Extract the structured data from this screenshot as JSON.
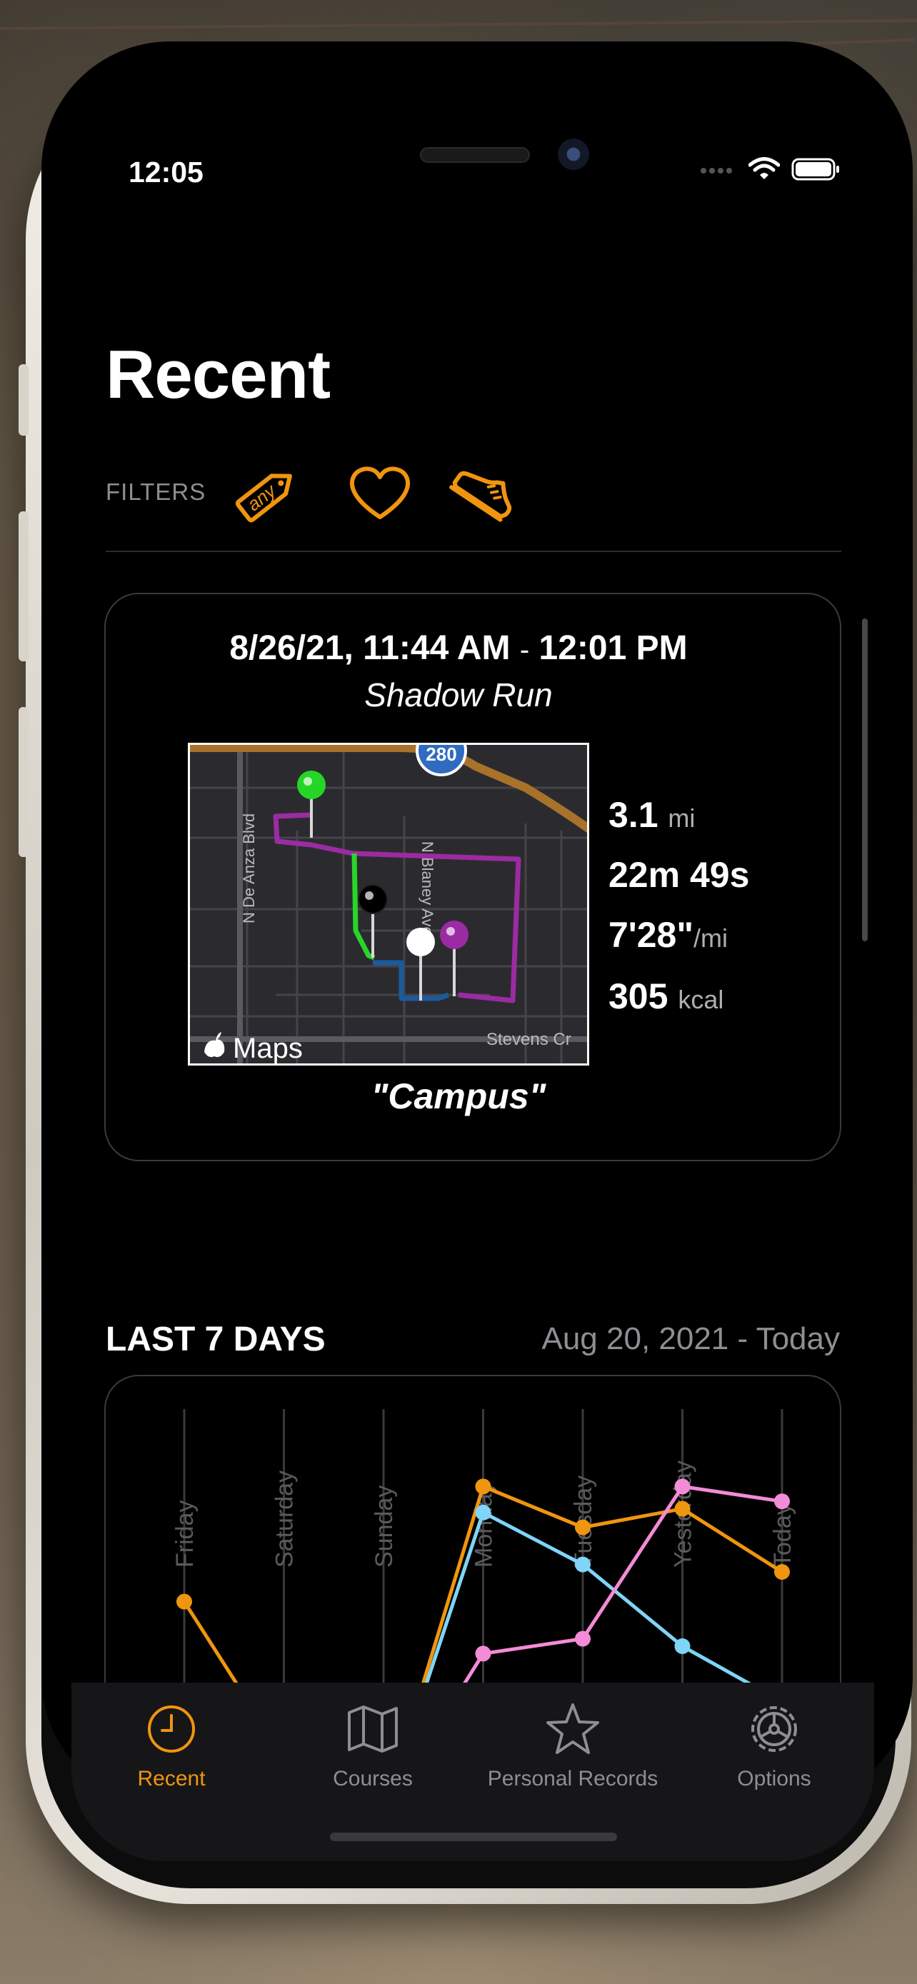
{
  "status": {
    "time": "12:05"
  },
  "header": {
    "title": "Recent"
  },
  "filters": {
    "label": "FILTERS",
    "any_label": "any"
  },
  "recent_run": {
    "time_start": "8/26/21, 11:44 AM",
    "time_sep": "-",
    "time_end": "12:01 PM",
    "subtitle": "Shadow Run",
    "course": "\"Campus\"",
    "map": {
      "shield": "280",
      "road_left": "N De Anza Blvd",
      "road_mid": "N Blaney Ave",
      "road_bottom": "Stevens Cr",
      "attribution": "Maps"
    },
    "stats": [
      {
        "value": "3.1",
        "unit": "mi"
      },
      {
        "value": "22m 49s",
        "unit": ""
      },
      {
        "value": "7'28\"",
        "unit": "/mi"
      },
      {
        "value": "305",
        "unit": "kcal"
      }
    ]
  },
  "last7": {
    "title": "LAST 7 DAYS",
    "range": "Aug 20, 2021  - Today"
  },
  "chart_data": {
    "type": "line",
    "categories": [
      "Friday",
      "Saturday",
      "Sunday",
      "Monday",
      "Tuesday",
      "Yesterday",
      "Today"
    ],
    "series": [
      {
        "color": "#f0950f",
        "values": [
          0.62,
          0.2,
          0.05,
          0.93,
          0.82,
          0.87,
          0.7
        ]
      },
      {
        "color": "#7fd4f7",
        "values": [
          null,
          null,
          0.05,
          0.86,
          0.72,
          0.5,
          0.35
        ]
      },
      {
        "color": "#f48bd7",
        "values": [
          null,
          null,
          0.05,
          0.48,
          0.52,
          0.93,
          0.89
        ]
      }
    ],
    "grid": true
  },
  "tabs": [
    {
      "label": "Recent",
      "icon": "clock-icon",
      "active": true
    },
    {
      "label": "Courses",
      "icon": "map-icon",
      "active": false
    },
    {
      "label": "Personal Records",
      "icon": "star-icon",
      "active": false
    },
    {
      "label": "Options",
      "icon": "gear-icon",
      "active": false
    }
  ],
  "colors": {
    "accent": "#f0950f",
    "background": "#000000"
  }
}
